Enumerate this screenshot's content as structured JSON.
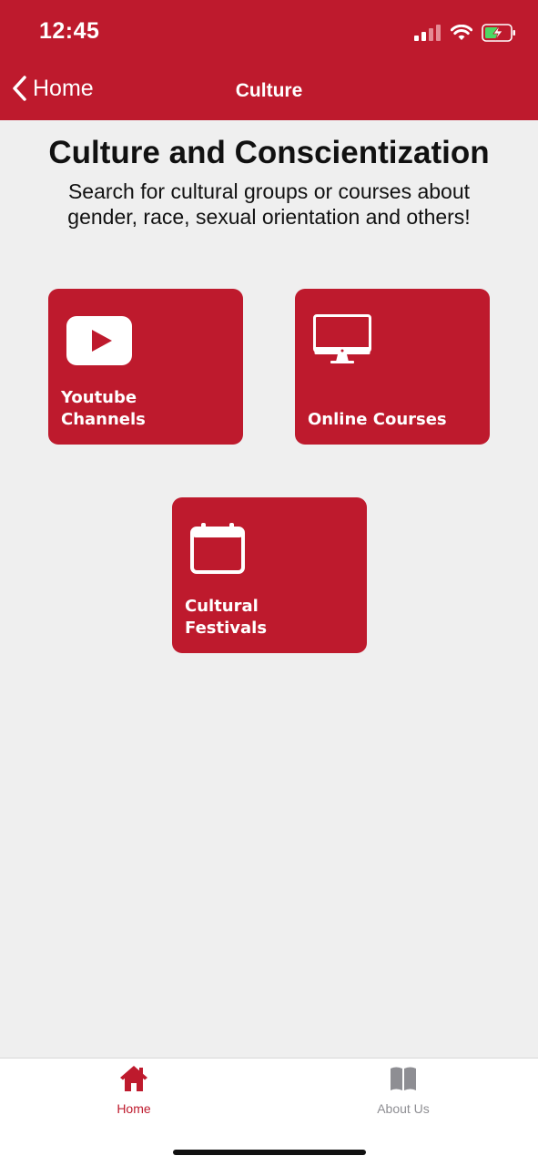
{
  "status_bar": {
    "time": "12:45"
  },
  "nav": {
    "back_label": "Home",
    "title": "Culture"
  },
  "page": {
    "heading": "Culture and Conscientization",
    "subtitle": "Search for cultural groups or courses about gender, race, sexual orientation and others!"
  },
  "tiles": [
    {
      "label_line1": "Youtube",
      "label_line2": "Channels",
      "icon": "youtube-icon"
    },
    {
      "label_line1": "Online Courses",
      "label_line2": "",
      "icon": "monitor-icon"
    },
    {
      "label_line1": "Cultural",
      "label_line2": "Festivals",
      "icon": "calendar-icon"
    }
  ],
  "tabbar": {
    "items": [
      {
        "label": "Home",
        "icon": "home-icon",
        "active": true
      },
      {
        "label": "About Us",
        "icon": "book-icon",
        "active": false
      }
    ]
  },
  "colors": {
    "brand": "#be1a2d",
    "background": "#efefef",
    "inactive_tab": "#8e8e93"
  }
}
